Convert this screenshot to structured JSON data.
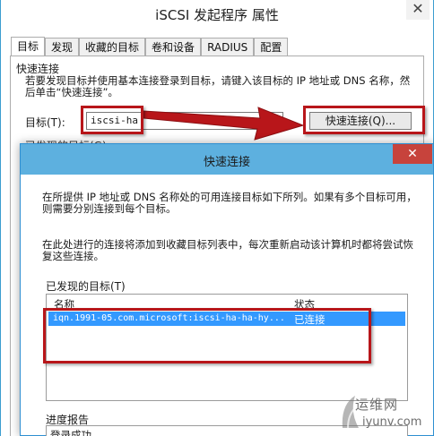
{
  "main_window": {
    "title": "iSCSI 发起程序 属性",
    "close_glyph": "✕",
    "tabs": [
      {
        "label": "目标",
        "active": true
      },
      {
        "label": "发现"
      },
      {
        "label": "收藏的目标"
      },
      {
        "label": "卷和设备"
      },
      {
        "label": "RADIUS"
      },
      {
        "label": "配置"
      }
    ],
    "quick_connect_group": "快速连接",
    "quick_connect_desc": "若要发现目标并使用基本连接登录到目标，请键入该目标的 IP 地址或 DNS 名称，然后单击“快速连接”。",
    "target_label": "目标(T):",
    "target_value": "iscsi-ha",
    "quick_connect_button": "快速连接(Q)...",
    "discovered_targets_partial": "已发现的目标(G)"
  },
  "dialog": {
    "title": "快速连接",
    "close_glyph": "✕",
    "desc1": "在所提供 IP 地址或 DNS 名称处的可用连接目标如下所列。如果有多个目标可用，则需要分别连接到每个目标。",
    "desc2": "在此处进行的连接将添加到收藏目标列表中，每次重新启动该计算机时都将尝试恢复这些连接。",
    "discovered_group": "已发现的目标(T)",
    "columns": {
      "name": "名称",
      "status": "状态"
    },
    "rows": [
      {
        "name": "iqn.1991-05.com.microsoft:iscsi-ha-ha-hy...",
        "status": "已连接"
      }
    ],
    "progress_group": "进度报告",
    "progress_text": "登录成功。"
  },
  "watermark": {
    "cn": "运维网",
    "en": "iyunv.com"
  },
  "colors": {
    "annotation": "#b8161a",
    "dialog_titlebar": "#5db0df",
    "selection": "#3399ff",
    "close_red": "#c7433c"
  }
}
